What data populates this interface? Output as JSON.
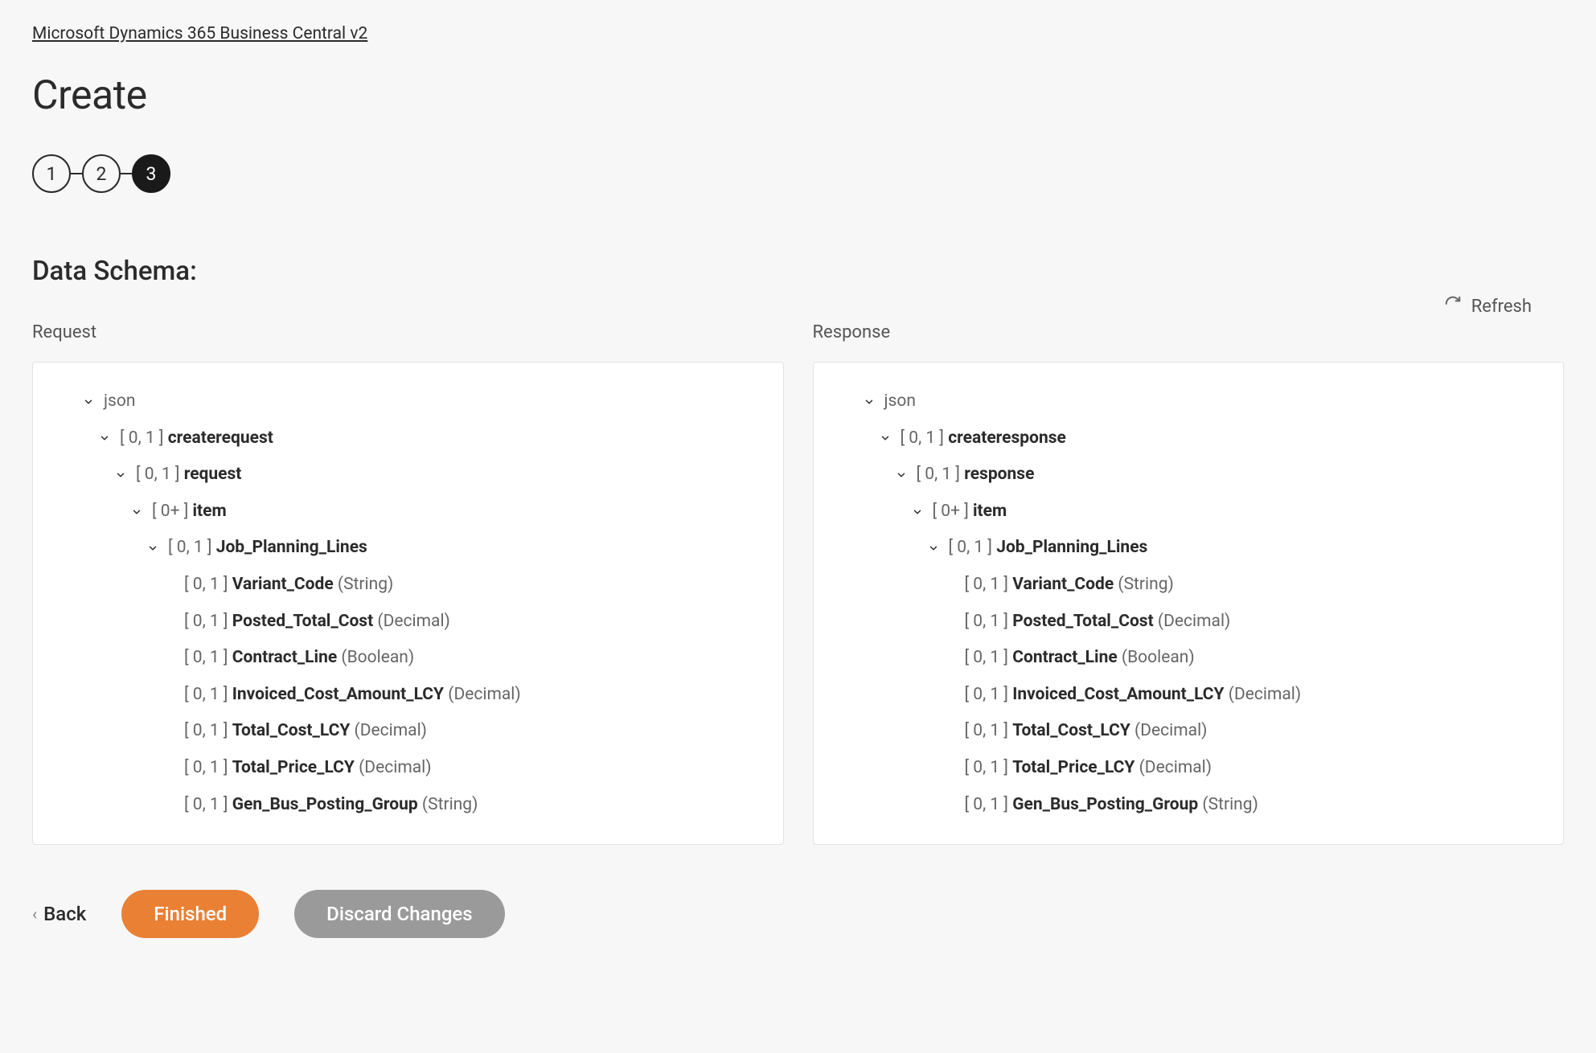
{
  "breadcrumb": "Microsoft Dynamics 365 Business Central v2",
  "page_title": "Create",
  "stepper": {
    "steps": [
      "1",
      "2",
      "3"
    ],
    "active_index": 2
  },
  "section_title": "Data Schema:",
  "refresh_label": "Refresh",
  "columns": {
    "request": {
      "label": "Request",
      "tree": [
        {
          "level": 0,
          "expandable": true,
          "card": "",
          "name": "json",
          "name_bold": false,
          "type": ""
        },
        {
          "level": 1,
          "expandable": true,
          "card": "[ 0, 1 ]",
          "name": "createrequest",
          "name_bold": true,
          "type": ""
        },
        {
          "level": 2,
          "expandable": true,
          "card": "[ 0, 1 ]",
          "name": "request",
          "name_bold": true,
          "type": ""
        },
        {
          "level": 3,
          "expandable": true,
          "card": "[ 0+ ]",
          "name": "item",
          "name_bold": true,
          "type": ""
        },
        {
          "level": 4,
          "expandable": true,
          "card": "[ 0, 1 ]",
          "name": "Job_Planning_Lines",
          "name_bold": true,
          "type": ""
        },
        {
          "level": 5,
          "expandable": false,
          "card": "[ 0, 1 ]",
          "name": "Variant_Code",
          "name_bold": true,
          "type": "(String)"
        },
        {
          "level": 5,
          "expandable": false,
          "card": "[ 0, 1 ]",
          "name": "Posted_Total_Cost",
          "name_bold": true,
          "type": "(Decimal)"
        },
        {
          "level": 5,
          "expandable": false,
          "card": "[ 0, 1 ]",
          "name": "Contract_Line",
          "name_bold": true,
          "type": "(Boolean)"
        },
        {
          "level": 5,
          "expandable": false,
          "card": "[ 0, 1 ]",
          "name": "Invoiced_Cost_Amount_LCY",
          "name_bold": true,
          "type": "(Decimal)"
        },
        {
          "level": 5,
          "expandable": false,
          "card": "[ 0, 1 ]",
          "name": "Total_Cost_LCY",
          "name_bold": true,
          "type": "(Decimal)"
        },
        {
          "level": 5,
          "expandable": false,
          "card": "[ 0, 1 ]",
          "name": "Total_Price_LCY",
          "name_bold": true,
          "type": "(Decimal)"
        },
        {
          "level": 5,
          "expandable": false,
          "card": "[ 0, 1 ]",
          "name": "Gen_Bus_Posting_Group",
          "name_bold": true,
          "type": "(String)"
        }
      ]
    },
    "response": {
      "label": "Response",
      "tree": [
        {
          "level": 0,
          "expandable": true,
          "card": "",
          "name": "json",
          "name_bold": false,
          "type": ""
        },
        {
          "level": 1,
          "expandable": true,
          "card": "[ 0, 1 ]",
          "name": "createresponse",
          "name_bold": true,
          "type": ""
        },
        {
          "level": 2,
          "expandable": true,
          "card": "[ 0, 1 ]",
          "name": "response",
          "name_bold": true,
          "type": ""
        },
        {
          "level": 3,
          "expandable": true,
          "card": "[ 0+ ]",
          "name": "item",
          "name_bold": true,
          "type": ""
        },
        {
          "level": 4,
          "expandable": true,
          "card": "[ 0, 1 ]",
          "name": "Job_Planning_Lines",
          "name_bold": true,
          "type": ""
        },
        {
          "level": 5,
          "expandable": false,
          "card": "[ 0, 1 ]",
          "name": "Variant_Code",
          "name_bold": true,
          "type": "(String)"
        },
        {
          "level": 5,
          "expandable": false,
          "card": "[ 0, 1 ]",
          "name": "Posted_Total_Cost",
          "name_bold": true,
          "type": "(Decimal)"
        },
        {
          "level": 5,
          "expandable": false,
          "card": "[ 0, 1 ]",
          "name": "Contract_Line",
          "name_bold": true,
          "type": "(Boolean)"
        },
        {
          "level": 5,
          "expandable": false,
          "card": "[ 0, 1 ]",
          "name": "Invoiced_Cost_Amount_LCY",
          "name_bold": true,
          "type": "(Decimal)"
        },
        {
          "level": 5,
          "expandable": false,
          "card": "[ 0, 1 ]",
          "name": "Total_Cost_LCY",
          "name_bold": true,
          "type": "(Decimal)"
        },
        {
          "level": 5,
          "expandable": false,
          "card": "[ 0, 1 ]",
          "name": "Total_Price_LCY",
          "name_bold": true,
          "type": "(Decimal)"
        },
        {
          "level": 5,
          "expandable": false,
          "card": "[ 0, 1 ]",
          "name": "Gen_Bus_Posting_Group",
          "name_bold": true,
          "type": "(String)"
        }
      ]
    }
  },
  "footer": {
    "back_label": "Back",
    "finished_label": "Finished",
    "discard_label": "Discard Changes"
  }
}
